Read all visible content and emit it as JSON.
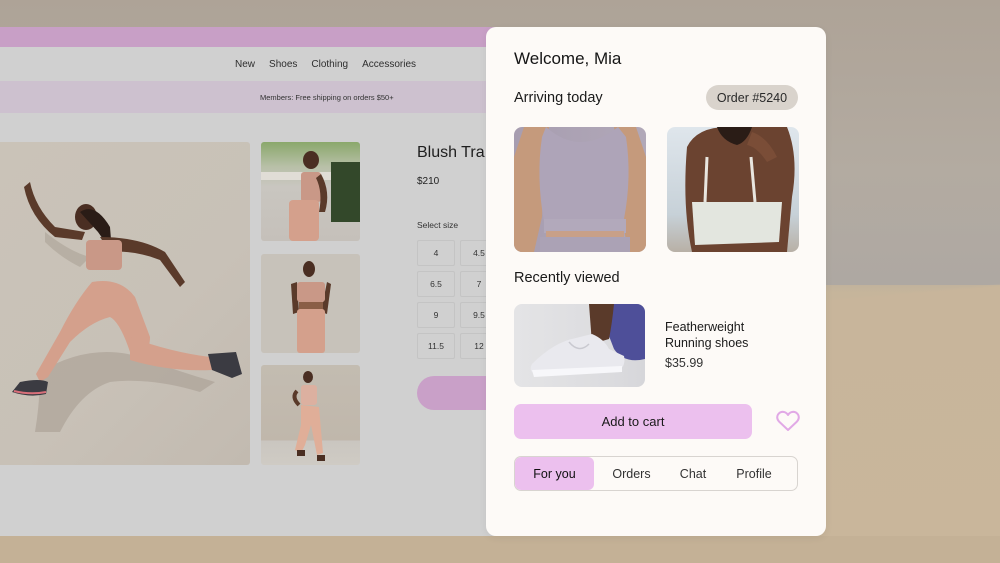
{
  "storefront": {
    "nav": [
      "New",
      "Shoes",
      "Clothing",
      "Accessories"
    ],
    "promo": "Members: Free shipping on orders $50+",
    "product": {
      "title": "Blush Tra",
      "price": "$210",
      "size_label": "Select size",
      "sizes": [
        "4",
        "4.5",
        "6.5",
        "7",
        "9",
        "9.5",
        "11.5",
        "12"
      ]
    },
    "colors": {
      "topbar": "#c89fc6",
      "promo_bg": "#cdc1cf",
      "cta": "#c9a0c8"
    }
  },
  "card": {
    "welcome": "Welcome, Mia",
    "arriving_title": "Arriving today",
    "order_badge": "Order #5240",
    "arriving_items": [
      {
        "image": "lavender sports bra front"
      },
      {
        "image": "white sports bra back"
      }
    ],
    "recent_title": "Recently viewed",
    "recent_item": {
      "name_line1": "Featherweight",
      "name_line2": "Running shoes",
      "price": "$35.99",
      "image": "white running shoe"
    },
    "add_to_cart": "Add to cart",
    "favorite_icon": "heart-icon",
    "tabs": [
      {
        "label": "For you",
        "active": true
      },
      {
        "label": "Orders",
        "active": false
      },
      {
        "label": "Chat",
        "active": false
      },
      {
        "label": "Profile",
        "active": false
      }
    ],
    "colors": {
      "accent": "#ecc0ee",
      "heart": "#e1a9e6",
      "badge_bg": "#d9d3cc"
    }
  }
}
